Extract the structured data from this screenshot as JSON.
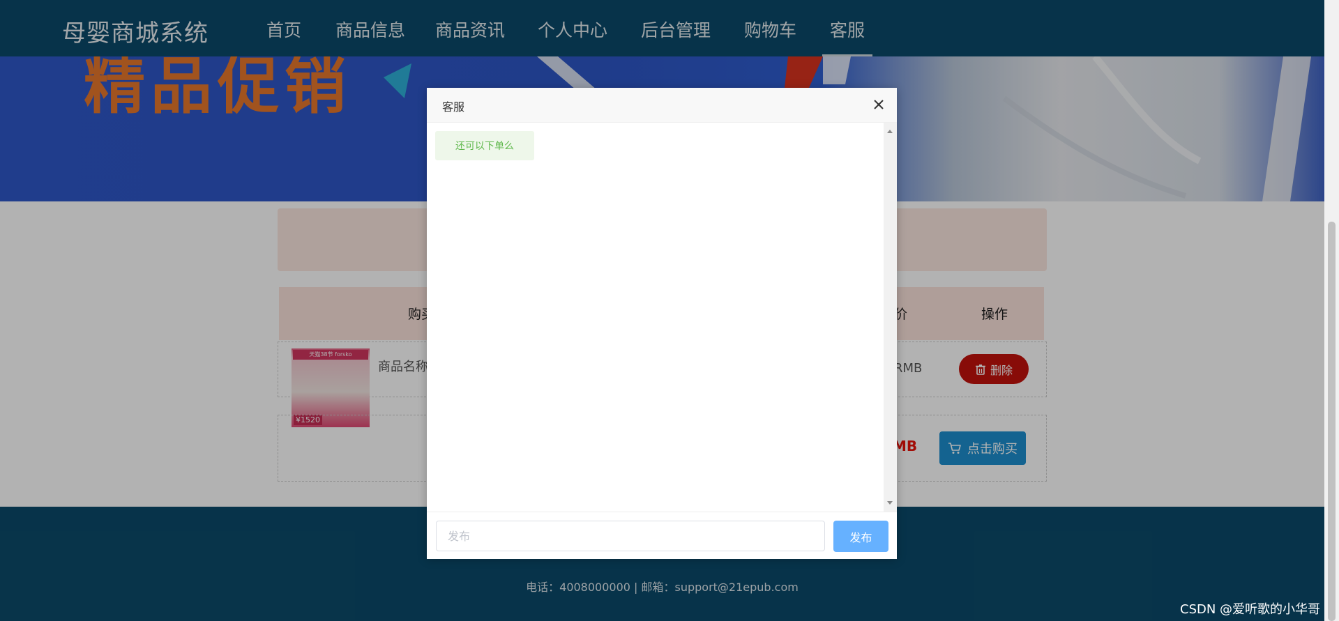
{
  "header": {
    "brand": "母婴商城系统",
    "nav": [
      {
        "label": "首页"
      },
      {
        "label": "商品信息"
      },
      {
        "label": "商品资讯"
      },
      {
        "label": "个人中心"
      },
      {
        "label": "后台管理"
      },
      {
        "label": "购物车"
      },
      {
        "label": "客服"
      }
    ],
    "active_nav": "客服"
  },
  "banner": {
    "text": "精品促销"
  },
  "cart": {
    "columns": [
      "购买",
      "价",
      "操作"
    ],
    "item": {
      "name": "商品名称",
      "image_tag": "天猫38节 forsko",
      "image_price": "¥1520",
      "price_suffix": "RMB",
      "delete_label": "删除"
    },
    "total_suffix": "MB",
    "buy_label": "点击购买"
  },
  "footer": {
    "contact": "电话：4008000000 | 邮箱：support@21epub.com"
  },
  "dialog": {
    "title": "客服",
    "messages": [
      {
        "text": "还可以下单么"
      }
    ],
    "input_placeholder": "发布",
    "input_value": "",
    "send_label": "发布"
  },
  "watermark": "CSDN @爱听歌的小华哥",
  "colors": {
    "nav_bg": "#0b4a6a",
    "footer_bg": "#0b4a6a",
    "delete_btn": "#c3120c",
    "buy_btn": "#1d8fcf",
    "send_btn": "#66b1ff",
    "message_text": "#5fb84c",
    "price_red": "#e8130b"
  },
  "icons": {
    "close": "close-icon",
    "trash": "trash-icon",
    "cart": "cart-icon"
  }
}
